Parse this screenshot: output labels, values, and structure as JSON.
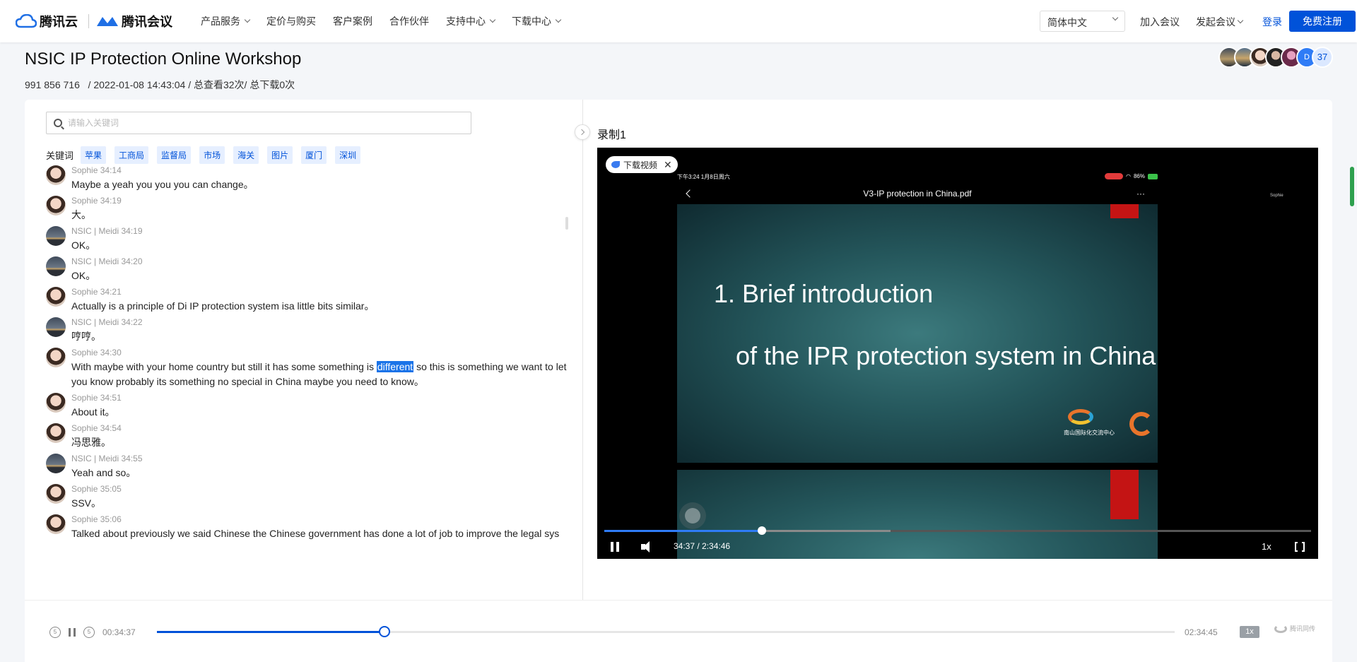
{
  "nav": {
    "brand1": "腾讯云",
    "brand2": "腾讯会议",
    "items": [
      {
        "label": "产品服务",
        "dropdown": true
      },
      {
        "label": "定价与购买",
        "dropdown": false
      },
      {
        "label": "客户案例",
        "dropdown": false
      },
      {
        "label": "合作伙伴",
        "dropdown": false
      },
      {
        "label": "支持中心",
        "dropdown": true
      },
      {
        "label": "下载中心",
        "dropdown": true
      }
    ],
    "language": "简体中文",
    "join": "加入会议",
    "start": "发起会议",
    "login": "登录",
    "register": "免费注册"
  },
  "meeting": {
    "title": "NSIC IP Protection Online Workshop",
    "id": "991 856 716",
    "datetime": "2022-01-08 14:43:04",
    "stats": "/ 总查看32次/ 总下载0次",
    "participant_count": "37"
  },
  "search": {
    "placeholder": "请输入关键词"
  },
  "keywords": {
    "label": "关键词",
    "items": [
      "苹果",
      "工商局",
      "监督局",
      "市场",
      "海关",
      "图片",
      "厦门",
      "深圳"
    ]
  },
  "transcript": [
    {
      "speaker": "Sophie",
      "time": "34:14",
      "avatar": "sophie",
      "text": "Maybe a yeah you you you can change。"
    },
    {
      "speaker": "Sophie",
      "time": "34:19",
      "avatar": "sophie",
      "text": "大。"
    },
    {
      "speaker": "NSIC | Meidi",
      "time": "34:19",
      "avatar": "nsic",
      "text": "OK。"
    },
    {
      "speaker": "NSIC | Meidi",
      "time": "34:20",
      "avatar": "nsic",
      "text": "OK。"
    },
    {
      "speaker": "Sophie",
      "time": "34:21",
      "avatar": "sophie",
      "text": "Actually is a principle of Di IP protection system isa little bits similar。"
    },
    {
      "speaker": "NSIC | Meidi",
      "time": "34:22",
      "avatar": "nsic",
      "text": "哼哼。"
    },
    {
      "speaker": "Sophie",
      "time": "34:30",
      "avatar": "sophie",
      "text_before": "With maybe with your home country but still it has some something is ",
      "highlight": "different",
      "text_after": " so this is something we want to let you know probably its something no special in China maybe you need to know。"
    },
    {
      "speaker": "Sophie",
      "time": "34:51",
      "avatar": "sophie",
      "text": "About it。"
    },
    {
      "speaker": "Sophie",
      "time": "34:54",
      "avatar": "sophie",
      "text": "冯思雅。"
    },
    {
      "speaker": "NSIC | Meidi",
      "time": "34:55",
      "avatar": "nsic",
      "text": "Yeah and so。"
    },
    {
      "speaker": "Sophie",
      "time": "35:05",
      "avatar": "sophie",
      "text": "SSV。"
    },
    {
      "speaker": "Sophie",
      "time": "35:06",
      "avatar": "sophie",
      "text": "Talked about previously we said Chinese the Chinese government has done a lot of job to improve the legal sys"
    }
  ],
  "recording": {
    "title": "录制1",
    "download_label": "下载视频",
    "phone_time": "下午3:24  1月8日周六",
    "phone_battery": "86%",
    "doc_title": "V3-IP protection in China.pdf",
    "slide_line1": "1. Brief introduction",
    "slide_line2": "of the IPR protection system in China",
    "slide_logo_text": "南山国际化交流中心",
    "presenter_label": "Sophie",
    "time_display": "34:37 / 2:34:46",
    "progress": 0.2233,
    "buffered": 0.405,
    "speed": "1x"
  },
  "playback": {
    "current": "00:34:37",
    "total": "02:34:45",
    "progress": 0.2233,
    "speed": "1x",
    "back_label": "5",
    "fwd_label": "5",
    "brand": "腾讯同传"
  }
}
